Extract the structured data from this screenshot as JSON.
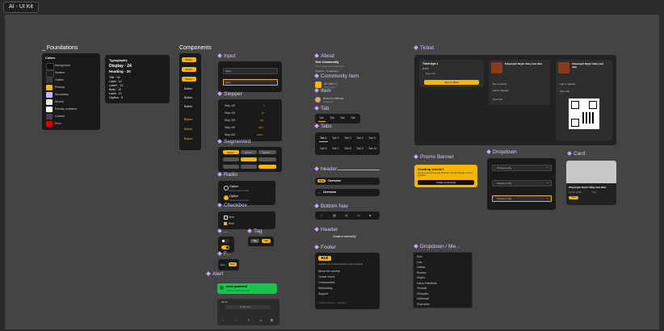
{
  "frame": {
    "title": "AI - UI Kit"
  },
  "sections": {
    "foundations": "Foundations",
    "components": "Components",
    "input": "Input",
    "stepper": "Stepper",
    "segmented": "Segmented",
    "radio": "Radio",
    "checkbox": "Checkbox",
    "toggle_short": "...",
    "tag": "Tag",
    "filter_short": "F...",
    "alert": "Alert",
    "about": "About",
    "community_item": "Community Item",
    "item": "Item",
    "tab": "Tab",
    "tabs": "Tabs",
    "header_lower": "header",
    "bottom_nav": "Bottom Nav",
    "header": "Header",
    "footer": "Footer",
    "ticket": "Ticket",
    "promo_banner": "Promo Banner",
    "dropdown": "Dropdown",
    "card": "Card",
    "dropdown_menu": "Dropdown / Me..."
  },
  "foundations": {
    "colors_title": "Colors",
    "color_names": [
      "Background",
      "Surface",
      "Outline",
      "Primary",
      "Secondary",
      "Accent",
      "Primary container",
      "Content",
      "Error"
    ],
    "colors": [
      "#111111",
      "#1e1e1e",
      "#3a3a3a",
      "#f5b800",
      "#c9b3ff",
      "#e6e6e6",
      "#ffffff",
      "#444444",
      "#e00000"
    ],
    "typo_title": "Typography",
    "typo": [
      "Display · 24",
      "Heading · 20",
      "Title · 16",
      "Label · 14",
      "Label+ · 12",
      "Body · 12",
      "Label · 10",
      "Caption · 8"
    ]
  },
  "components": {
    "buttons": [
      "Button",
      "Button",
      "Button",
      "Button",
      "Button",
      "Button",
      "Button",
      "Button",
      "Button"
    ]
  },
  "input": {
    "placeholder_1": "Input",
    "placeholder_2": "Input"
  },
  "stepper": {
    "rows": [
      "Step 1/5",
      "Step 2/5",
      "Step 3/5",
      "Step 4/5",
      "Step 5/5"
    ]
  },
  "segmented": {
    "options": [
      "Option",
      "Option",
      "Option"
    ]
  },
  "radio": {
    "label_1": "Option",
    "sub_1": "Option description",
    "label_2": "Option",
    "sub_2": "Option description"
  },
  "checkbox": {
    "label_1": "Item",
    "label_2": "Item"
  },
  "tag": {
    "label_1": "Tag",
    "label_2": "Tag"
  },
  "filter": {
    "label_1": "Item",
    "label_2": "Item"
  },
  "alert": {
    "title": "Invite published",
    "body": "Lorem ipsum dolor sit"
  },
  "mobile": {
    "time": "09:41",
    "url": "ai-uikit.com"
  },
  "about": {
    "title": "Text Community",
    "desc": "Community description text",
    "stat_1": "3 events",
    "stat_2": "8 members"
  },
  "community_item": {
    "name": "UX Club ru",
    "sub": "Community"
  },
  "item": {
    "name": "Anna Kuznetsova",
    "sub": "Organizer"
  },
  "tab": {
    "labels": [
      "Tab",
      "Tab",
      "Tab",
      "Tab"
    ]
  },
  "tabs": {
    "labels": [
      "Tab 1",
      "Tab 2",
      "Tab 3",
      "Tab 4",
      "Tab 5",
      "Tab 6",
      "Tab 7",
      "Tab 8",
      "Tab 9",
      "Tab 10"
    ]
  },
  "header_lower": {
    "logo": "Rofi",
    "title": "Overview",
    "back_title": "Overview"
  },
  "header": {
    "title": "Create a community"
  },
  "footer": {
    "logo": "Rofi",
    "tagline": "A platform for IT and business events in Ukraine",
    "links": [
      "About the service",
      "Create event",
      "Communities",
      "Networking",
      "Support"
    ],
    "copyright": "© 2024 AI Events — All rights"
  },
  "ticket": {
    "type": "Ticket type 1",
    "price": "₴ 450",
    "option": "Early bird",
    "buy_label": "Buy for ₴450",
    "event_title_1": "Playwright Night: Baby tied after",
    "event_title_2": "Playwright Night: Baby tied after",
    "add_1": "Buy to rewind",
    "add_2": "Add to calendar",
    "open_qr_1": "Open QR",
    "open_qr_2": "Open QR",
    "add_3": "Add to calendar"
  },
  "promo": {
    "title": "Creating events?",
    "body": "Set up a community and share the link with friends. Grow it together.",
    "button": "Create community"
  },
  "dropdown": {
    "items": [
      "Choose a city",
      "Choose a city",
      "Choose a city"
    ]
  },
  "card": {
    "title": "Playwright Night: Baby tied after",
    "date": "Oct 24, 19:00",
    "place": "Kyiv",
    "tag": "Free"
  },
  "dropdown_menu": {
    "items": [
      "Kyiv",
      "Lviv",
      "Odesa",
      "Kharkiv",
      "Dnipro",
      "Ivano-Frankivsk",
      "Ternopil",
      "Vinnytsia",
      "Uzhhorod",
      "Chernivtsi"
    ]
  }
}
